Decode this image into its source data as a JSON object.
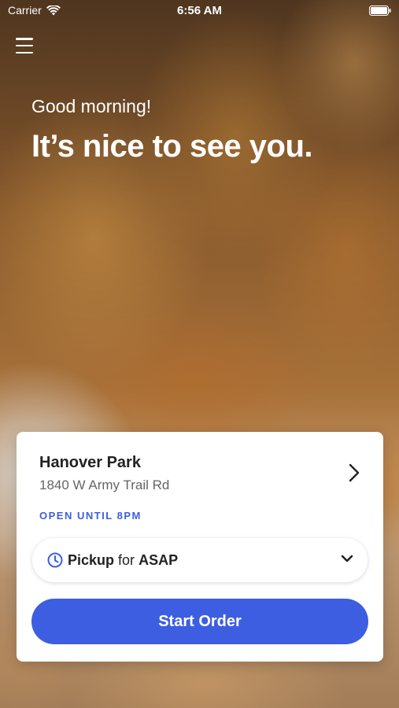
{
  "status_bar": {
    "carrier": "Carrier",
    "time": "6:56 AM"
  },
  "hero": {
    "greeting": "Good morning!",
    "headline": "It’s nice to see you."
  },
  "location_card": {
    "name": "Hanover Park",
    "address": "1840 W Army Trail Rd",
    "hours": "OPEN UNTIL 8PM",
    "pickup": {
      "mode": "Pickup",
      "connector": "for",
      "when": "ASAP"
    },
    "start_button": "Start Order"
  },
  "colors": {
    "accent": "#3d5ee0",
    "card_bg": "#ffffff",
    "text_dark": "#222222",
    "text_muted": "#666666"
  },
  "icons": {
    "menu": "hamburger-icon",
    "wifi": "wifi-icon",
    "battery": "battery-icon",
    "chevron_right": "chevron-right-icon",
    "clock": "clock-icon",
    "chevron_down": "chevron-down-icon"
  }
}
